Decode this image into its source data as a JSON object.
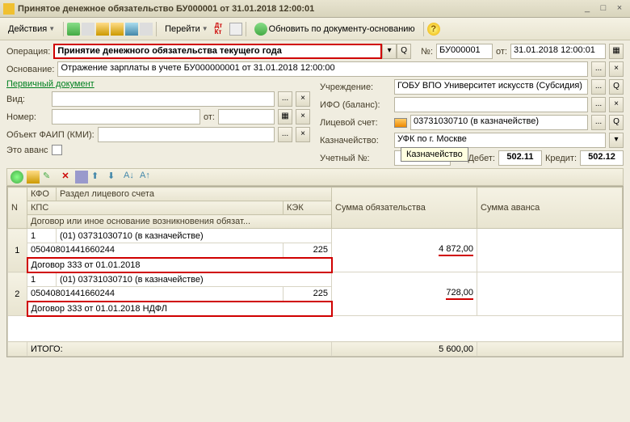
{
  "window": {
    "title": "Принятое денежное обязательство БУ000001 от 31.01.2018 12:00:01"
  },
  "toolbar": {
    "actions": "Действия",
    "goto": "Перейти",
    "update": "Обновить по документу-основанию"
  },
  "labels": {
    "operation": "Операция:",
    "number": "№:",
    "from": "от:",
    "basis": "Основание:",
    "primary_doc": "Первичный документ",
    "institution": "Учреждение:",
    "type": "Вид:",
    "ifo": "ИФО (баланс):",
    "number2": "Номер:",
    "from2": "от:",
    "personal_account": "Лицевой счет:",
    "faip": "Объект ФАИП (КМИ):",
    "treasury": "Казначейство:",
    "advance": "Это аванс",
    "accounting_no": "Учетный №:",
    "debit": "Дебет:",
    "credit": "Кредит:"
  },
  "values": {
    "operation": "Принятие денежного обязательства текущего года",
    "doc_number": "БУ000001",
    "doc_date": "31.01.2018 12:00:01",
    "basis": "Отражение зарплаты в учете БУ000000001 от 31.01.2018 12:00:00",
    "institution": "ГОБУ ВПО Университет искусств (Субсидия)",
    "personal_account": "03731030710 (в казначействе)",
    "treasury": "УФК по г. Москве",
    "debit": "502.11",
    "credit": "502.12"
  },
  "tooltip": "Казначейство",
  "grid": {
    "headers": {
      "n": "N",
      "kfo": "КФО",
      "section": "Раздел лицевого счета",
      "kps": "КПС",
      "kek": "КЭК",
      "contract": "Договор или иное основание возникновения обязат...",
      "sum_oblig": "Сумма обязательства",
      "sum_advance": "Сумма аванса"
    },
    "rows": [
      {
        "n": "1",
        "kfo": "1",
        "section": "(01) 03731030710 (в казначействе)",
        "kps": "05040801441660244",
        "kek": "225",
        "contract": "Договор 333 от 01.01.2018",
        "sum": "4 872,00"
      },
      {
        "n": "2",
        "kfo": "1",
        "section": "(01) 03731030710 (в казначействе)",
        "kps": "05040801441660244",
        "kek": "225",
        "contract": "Договор 333 от 01.01.2018  НДФЛ",
        "sum": "728,00"
      }
    ],
    "total_label": "ИТОГО:",
    "total": "5 600,00"
  }
}
